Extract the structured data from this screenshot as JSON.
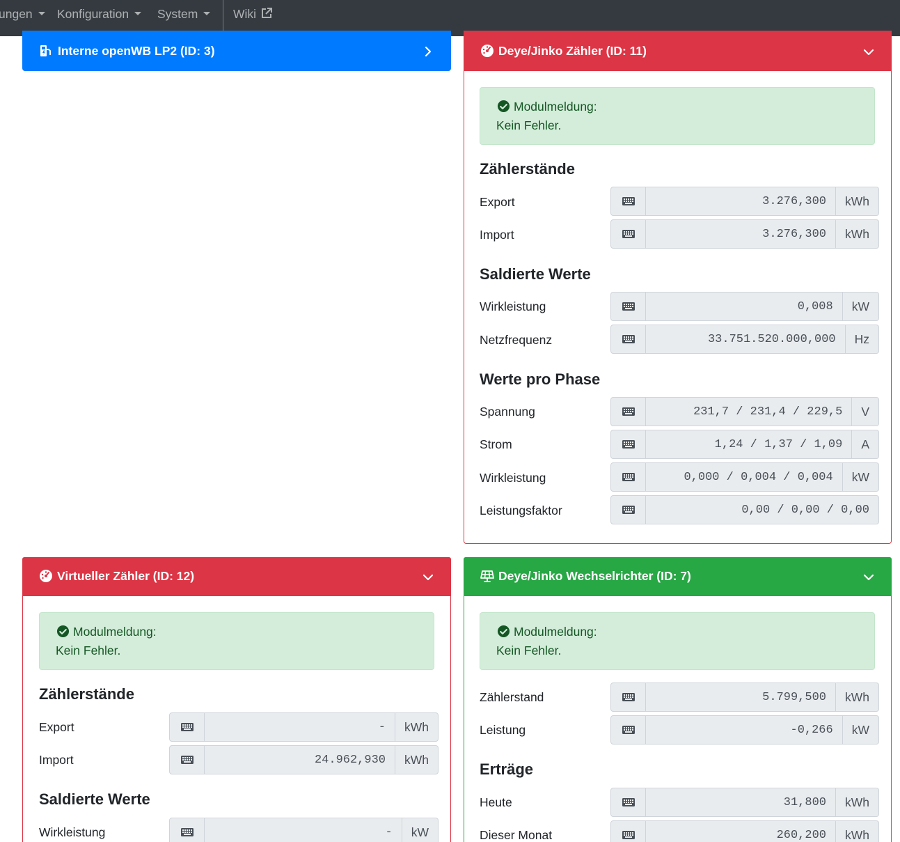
{
  "navbar": {
    "items": [
      {
        "label": "ungen"
      },
      {
        "label": "Konfiguration"
      },
      {
        "label": "System"
      },
      {
        "label": "Wiki"
      }
    ]
  },
  "cards": {
    "lp2": {
      "title": "Interne openWB LP2 (ID: 3)",
      "color": "#007bff"
    },
    "deye_meter": {
      "title": "Deye/Jinko Zähler (ID: 11)",
      "color": "#dc3545",
      "alert": {
        "title": "Modulmeldung:",
        "text": "Kein Fehler."
      },
      "counters_title": "Zählerstände",
      "export": {
        "label": "Export",
        "value": "3.276,300",
        "unit": "kWh"
      },
      "import": {
        "label": "Import",
        "value": "3.276,300",
        "unit": "kWh"
      },
      "balanced_title": "Saldierte Werte",
      "power": {
        "label": "Wirkleistung",
        "value": "0,008",
        "unit": "kW"
      },
      "frequency": {
        "label": "Netzfrequenz",
        "value": "33.751.520.000,000",
        "unit": "Hz"
      },
      "phase_title": "Werte pro Phase",
      "voltage": {
        "label": "Spannung",
        "value": "231,7 / 231,4 / 229,5",
        "unit": "V"
      },
      "current": {
        "label": "Strom",
        "value": "1,24 / 1,37 / 1,09",
        "unit": "A"
      },
      "phase_power": {
        "label": "Wirkleistung",
        "value": "0,000 / 0,004 / 0,004",
        "unit": "kW"
      },
      "power_factor": {
        "label": "Leistungsfaktor",
        "value": "0,00 / 0,00 / 0,00"
      }
    },
    "virtual_meter": {
      "title": "Virtueller Zähler (ID: 12)",
      "color": "#dc3545",
      "alert": {
        "title": "Modulmeldung:",
        "text": "Kein Fehler."
      },
      "counters_title": "Zählerstände",
      "export": {
        "label": "Export",
        "value": "-",
        "unit": "kWh"
      },
      "import": {
        "label": "Import",
        "value": "24.962,930",
        "unit": "kWh"
      },
      "balanced_title": "Saldierte Werte",
      "power": {
        "label": "Wirkleistung",
        "value": "-",
        "unit": "kW"
      }
    },
    "inverter": {
      "title": "Deye/Jinko Wechselrichter (ID: 7)",
      "color": "#28a745",
      "alert": {
        "title": "Modulmeldung:",
        "text": "Kein Fehler."
      },
      "counter": {
        "label": "Zählerstand",
        "value": "5.799,500",
        "unit": "kWh"
      },
      "power": {
        "label": "Leistung",
        "value": "-0,266",
        "unit": "kW"
      },
      "yields_title": "Erträge",
      "today": {
        "label": "Heute",
        "value": "31,800",
        "unit": "kWh"
      },
      "month": {
        "label": "Dieser Monat",
        "value": "260,200",
        "unit": "kWh"
      }
    }
  }
}
